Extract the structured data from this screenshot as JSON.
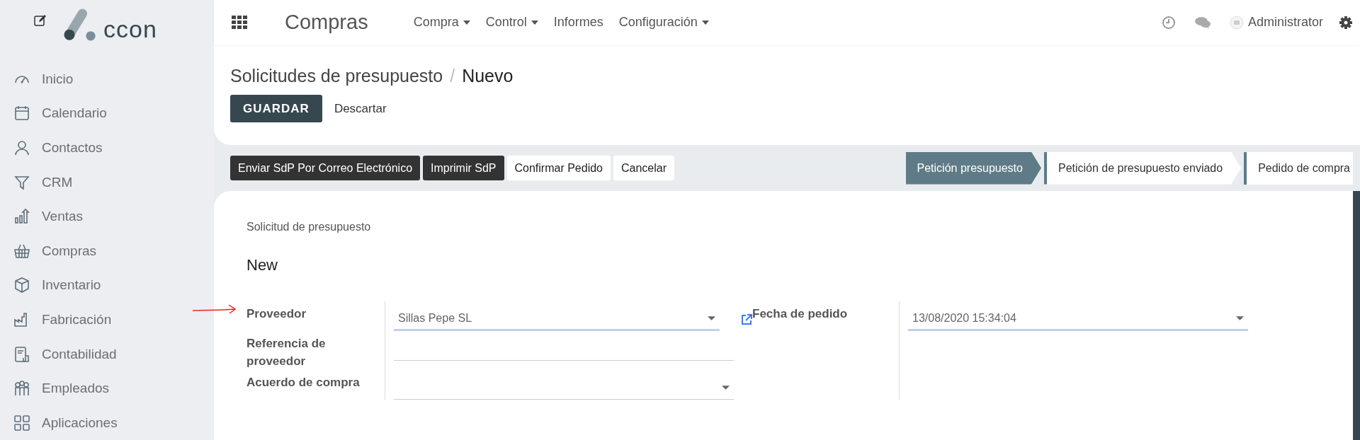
{
  "sidebar": {
    "logo_text": "ccon",
    "items": [
      {
        "label": "Inicio",
        "selected": false
      },
      {
        "label": "Calendario",
        "selected": false
      },
      {
        "label": "Contactos",
        "selected": false
      },
      {
        "label": "CRM",
        "selected": false
      },
      {
        "label": "Ventas",
        "selected": false
      },
      {
        "label": "Compras",
        "selected": false
      },
      {
        "label": "Inventario",
        "selected": false
      },
      {
        "label": "Fabricación",
        "selected": false
      },
      {
        "label": "Contabilidad",
        "selected": false
      },
      {
        "label": "Empleados",
        "selected": false
      },
      {
        "label": "Aplicaciones",
        "selected": false
      }
    ]
  },
  "topbar": {
    "app_title": "Compras",
    "menus": [
      {
        "label": "Compra",
        "dropdown": true
      },
      {
        "label": "Control",
        "dropdown": true
      },
      {
        "label": "Informes",
        "dropdown": false
      },
      {
        "label": "Configuración",
        "dropdown": true
      }
    ],
    "user": "Administrator"
  },
  "breadcrumb": {
    "parent": "Solicitudes de presupuesto",
    "separator": "/",
    "current": "Nuevo"
  },
  "actions": {
    "save": "GUARDAR",
    "discard": "Descartar"
  },
  "form_buttons": [
    {
      "label": "Enviar SdP Por Correo Electrónico",
      "kind": "primary"
    },
    {
      "label": "Imprimir SdP",
      "kind": "primary"
    },
    {
      "label": "Confirmar Pedido",
      "kind": "secondary"
    },
    {
      "label": "Cancelar",
      "kind": "secondary"
    }
  ],
  "status_steps": [
    {
      "label": "Petición presupuesto",
      "selected": true
    },
    {
      "label": "Petición de presupuesto enviado",
      "selected": false
    },
    {
      "label": "Pedido de compra",
      "selected": false
    }
  ],
  "sheet": {
    "subtitle": "Solicitud de presupuesto",
    "name": "New",
    "left_fields": [
      {
        "label": "Proveedor",
        "value": "Sillas Pepe SL",
        "kind": "select",
        "focused": true,
        "external_link": true
      },
      {
        "label": "Referencia de proveedor",
        "kind": "text",
        "focused": false,
        "external_link": false
      },
      {
        "label": "Acuerdo de compra",
        "kind": "select",
        "focused": false,
        "external_link": false
      }
    ],
    "right_fields": [
      {
        "label": "Fecha de pedido",
        "value": "13/08/2020 15:34:04",
        "kind": "select",
        "focused": true,
        "external_link": false
      }
    ]
  }
}
